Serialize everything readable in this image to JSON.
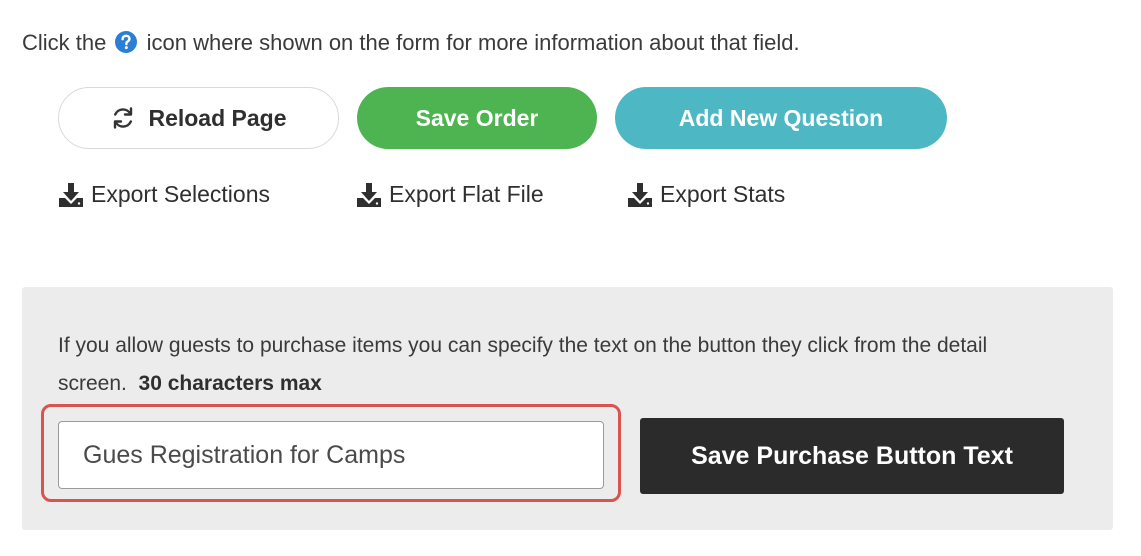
{
  "help": {
    "prefix": "Click the",
    "suffix": "icon where shown on the form for more information about that field.",
    "icon": "question-circle-icon",
    "icon_color": "#2a7fd4"
  },
  "buttons": {
    "reload": {
      "label": "Reload Page",
      "icon": "refresh-icon"
    },
    "save_order": {
      "label": "Save Order",
      "color": "#4db451"
    },
    "add_question": {
      "label": "Add New Question",
      "color": "#4db8c4"
    }
  },
  "exports": {
    "selections": {
      "label": "Export Selections",
      "icon": "download-icon"
    },
    "flat_file": {
      "label": "Export Flat File",
      "icon": "download-icon"
    },
    "stats": {
      "label": "Export Stats",
      "icon": "download-icon"
    }
  },
  "guest_panel": {
    "description": "If you allow guests to purchase items you can specify the text on the button they click from the detail screen.",
    "limit": "30 characters max",
    "input_value": "Gues Registration for Camps",
    "save_label": "Save Purchase Button Text",
    "highlight_color": "#d9534f"
  }
}
